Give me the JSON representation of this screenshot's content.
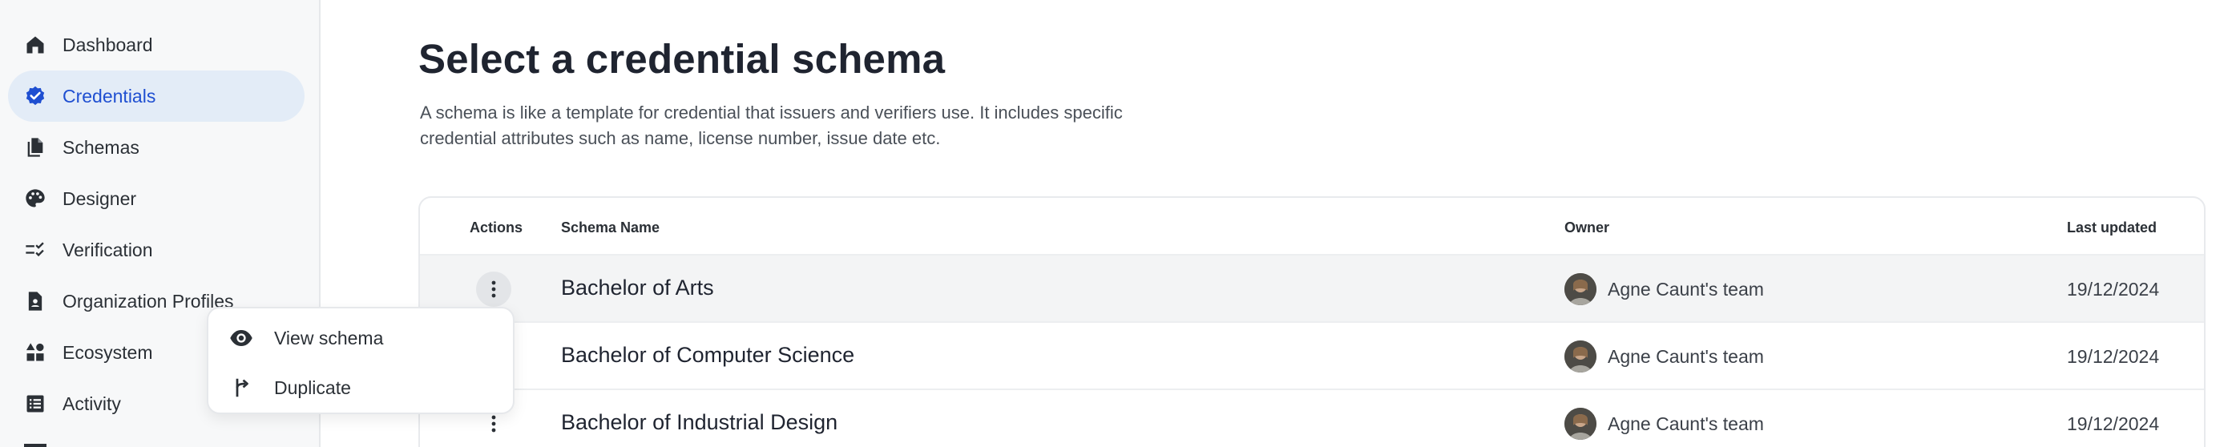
{
  "sidebar": {
    "items": [
      {
        "label": "Dashboard",
        "icon": "home-icon"
      },
      {
        "label": "Credentials",
        "icon": "verified-badge-icon",
        "active": true
      },
      {
        "label": "Schemas",
        "icon": "documents-icon"
      },
      {
        "label": "Designer",
        "icon": "palette-icon"
      },
      {
        "label": "Verification",
        "icon": "checklist-icon"
      },
      {
        "label": "Organization Profiles",
        "icon": "badge-icon"
      },
      {
        "label": "Ecosystem",
        "icon": "category-icon"
      },
      {
        "label": "Activity",
        "icon": "list-icon"
      }
    ]
  },
  "main": {
    "title": "Select a credential schema",
    "description": "A schema is like a template for credential that issuers and verifiers use. It includes specific credential attributes such as name, license number, issue date etc.",
    "table": {
      "headers": {
        "actions": "Actions",
        "name": "Schema Name",
        "owner": "Owner",
        "updated": "Last updated"
      },
      "rows": [
        {
          "name": "Bachelor of Arts",
          "owner": "Agne Caunt's team",
          "updated": "19/12/2024"
        },
        {
          "name": "Bachelor of Computer Science",
          "owner": "Agne Caunt's team",
          "updated": "19/12/2024"
        },
        {
          "name": "Bachelor of Industrial Design",
          "owner": "Agne Caunt's team",
          "updated": "19/12/2024"
        }
      ]
    }
  },
  "context_menu": {
    "items": [
      {
        "label": "View schema",
        "icon": "eye-icon"
      },
      {
        "label": "Duplicate",
        "icon": "duplicate-icon"
      }
    ]
  },
  "colors": {
    "accent": "#1f4fd1",
    "active_bg": "#e3ecf7",
    "sidebar_bg": "#f7f8f9",
    "text": "#1f2430"
  }
}
